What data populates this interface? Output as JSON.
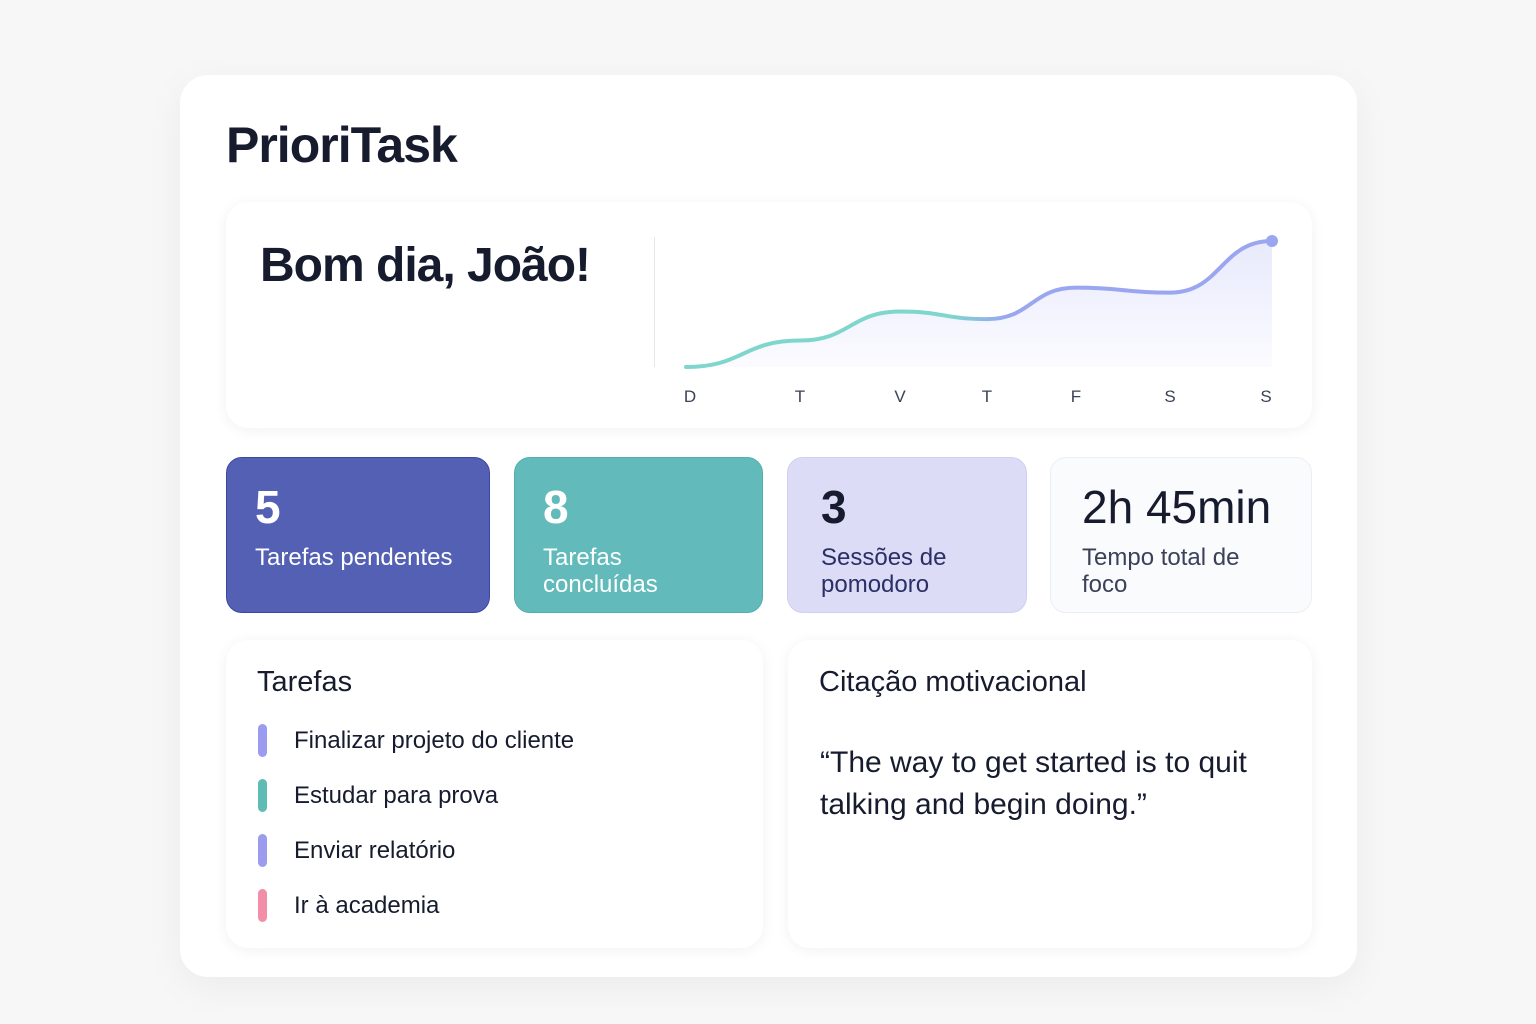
{
  "app": {
    "title": "PrioriTask"
  },
  "greeting": "Bom dia, João!",
  "chart_data": {
    "type": "line",
    "title": "",
    "xlabel": "",
    "ylabel": "",
    "categories": [
      "D",
      "T",
      "V",
      "T",
      "F",
      "S",
      "S"
    ],
    "values": [
      0,
      21,
      44,
      38,
      63,
      59,
      100
    ],
    "ylim": [
      0,
      100
    ],
    "grid": false,
    "colors": [
      "#7fd6cc",
      "#9aa6f0"
    ]
  },
  "stats": [
    {
      "value": "5",
      "label": "Tarefas pendentes"
    },
    {
      "value": "8",
      "label": "Tarefas concluídas"
    },
    {
      "value": "3",
      "label": "Sessões de pomodoro"
    },
    {
      "value": "2h 45min",
      "label": "Tempo total de foco"
    }
  ],
  "tasks": {
    "heading": "Tarefas",
    "items": [
      {
        "label": "Finalizar projeto do cliente",
        "color": "#9b9cf0"
      },
      {
        "label": "Estudar para prova",
        "color": "#5fbcb5"
      },
      {
        "label": "Enviar relatório",
        "color": "#9b9cf0"
      },
      {
        "label": "Ir à academia",
        "color": "#f28ea8"
      }
    ]
  },
  "quote": {
    "heading": "Citação motivacional",
    "text": "“The way to get started is to quit talking and begin doing.”"
  }
}
